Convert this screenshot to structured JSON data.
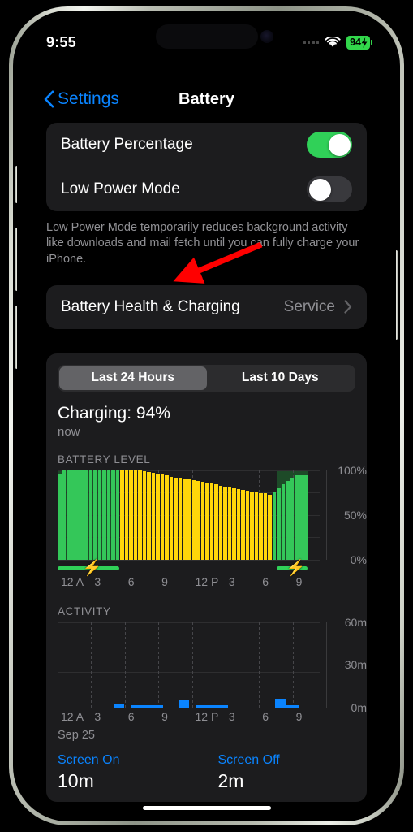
{
  "status_bar": {
    "time": "9:55",
    "battery_percent": "94",
    "battery_charging_icon": "bolt-icon",
    "wifi_icon": "wifi-icon",
    "signal_icon": "cellular-dots-icon",
    "battery_fill_color": "#32d74b"
  },
  "nav": {
    "back_label": "Settings",
    "back_icon": "chevron-left-icon",
    "title": "Battery",
    "tint_color": "#0a84ff"
  },
  "settings": {
    "battery_percentage_label": "Battery Percentage",
    "battery_percentage_on": true,
    "low_power_mode_label": "Low Power Mode",
    "low_power_mode_on": false,
    "footnote": "Low Power Mode temporarily reduces background activity like downloads and mail fetch until you can fully charge your iPhone.",
    "battery_health_label": "Battery Health & Charging",
    "battery_health_value": "Service",
    "battery_health_chevron": "chevron-right-icon"
  },
  "stats": {
    "segments": [
      {
        "label": "Last 24 Hours",
        "active": true
      },
      {
        "label": "Last 10 Days",
        "active": false
      }
    ],
    "charging_status": "Charging: 94%",
    "charging_time": "now",
    "date_label": "Sep 25",
    "screen_on_label": "Screen On",
    "screen_on_value": "10m",
    "screen_off_label": "Screen Off",
    "screen_off_value": "2m"
  },
  "chart_data": [
    {
      "type": "bar",
      "name": "battery-level-chart",
      "title": "BATTERY LEVEL",
      "xlabel": "",
      "ylabel": "",
      "ylim": [
        0,
        100
      ],
      "ytick_labels": [
        "100%",
        "50%",
        "0%"
      ],
      "ytick_values": [
        100,
        50,
        0
      ],
      "xtick_labels": [
        "12 A",
        "3",
        "6",
        "9",
        "12 P",
        "3",
        "6",
        "9"
      ],
      "xtick_hours": [
        0,
        3,
        6,
        9,
        12,
        15,
        18,
        21
      ],
      "grid": true,
      "legend": "none",
      "bar_colors": {
        "charging": "#34c759",
        "discharging": "#ffd60a"
      },
      "charging_region_color": "#1d4a28",
      "x_hours": [
        0,
        0.4,
        0.8,
        1.2,
        1.6,
        2.0,
        2.4,
        2.8,
        3.2,
        3.6,
        4.0,
        4.4,
        4.8,
        5.2,
        5.6,
        6.0,
        6.4,
        6.8,
        7.2,
        7.6,
        8.0,
        8.4,
        8.8,
        9.2,
        9.6,
        10.0,
        10.4,
        10.8,
        11.2,
        11.6,
        12.0,
        12.4,
        12.8,
        13.2,
        13.6,
        14.0,
        14.4,
        14.8,
        15.2,
        15.6,
        16.0,
        16.4,
        16.8,
        17.2,
        17.6,
        18.0,
        18.4,
        18.8,
        19.2,
        19.6,
        20.0,
        20.4,
        20.8,
        21.2,
        21.6,
        22.0
      ],
      "values": [
        96,
        100,
        100,
        100,
        100,
        100,
        100,
        100,
        100,
        100,
        100,
        100,
        100,
        100,
        100,
        100,
        100,
        100,
        100,
        99,
        98,
        97,
        96,
        95,
        94,
        93,
        92,
        92,
        91,
        90,
        89,
        88,
        87,
        86,
        85,
        84,
        83,
        82,
        81,
        80,
        79,
        78,
        77,
        76,
        75,
        74,
        74,
        73,
        76,
        80,
        84,
        88,
        92,
        94,
        94,
        94
      ],
      "charging_flags": [
        true,
        true,
        true,
        true,
        true,
        true,
        true,
        true,
        true,
        true,
        true,
        true,
        true,
        true,
        false,
        false,
        false,
        false,
        false,
        false,
        false,
        false,
        false,
        false,
        false,
        false,
        false,
        false,
        false,
        false,
        false,
        false,
        false,
        false,
        false,
        false,
        false,
        false,
        false,
        false,
        false,
        false,
        false,
        false,
        false,
        false,
        false,
        false,
        true,
        true,
        true,
        true,
        true,
        true,
        true,
        true
      ],
      "charging_sessions": [
        {
          "start_hour": 0,
          "end_hour": 5.5
        },
        {
          "start_hour": 19.6,
          "end_hour": 22.3
        }
      ]
    },
    {
      "type": "bar",
      "name": "activity-chart",
      "title": "ACTIVITY",
      "xlabel": "",
      "ylabel": "",
      "ylim": [
        0,
        60
      ],
      "ytick_labels": [
        "60m",
        "30m",
        "0m"
      ],
      "ytick_values": [
        60,
        30,
        0
      ],
      "xtick_labels": [
        "12 A",
        "3",
        "6",
        "9",
        "12 P",
        "3",
        "6",
        "9"
      ],
      "xtick_hours": [
        0,
        3,
        6,
        9,
        12,
        15,
        18,
        21
      ],
      "grid": true,
      "legend": "none",
      "bar_color": "#0a84ff",
      "unit": "minutes",
      "x_hours": [
        5.0,
        6.6,
        7.4,
        8.2,
        10.8,
        12.4,
        13.2,
        14.0,
        19.4,
        20.4
      ],
      "values": [
        3,
        1,
        1,
        1,
        5,
        1,
        1,
        1,
        6,
        1
      ]
    }
  ],
  "annotation": {
    "arrow_color": "#ff0000",
    "points_to": "battery-health-row"
  }
}
